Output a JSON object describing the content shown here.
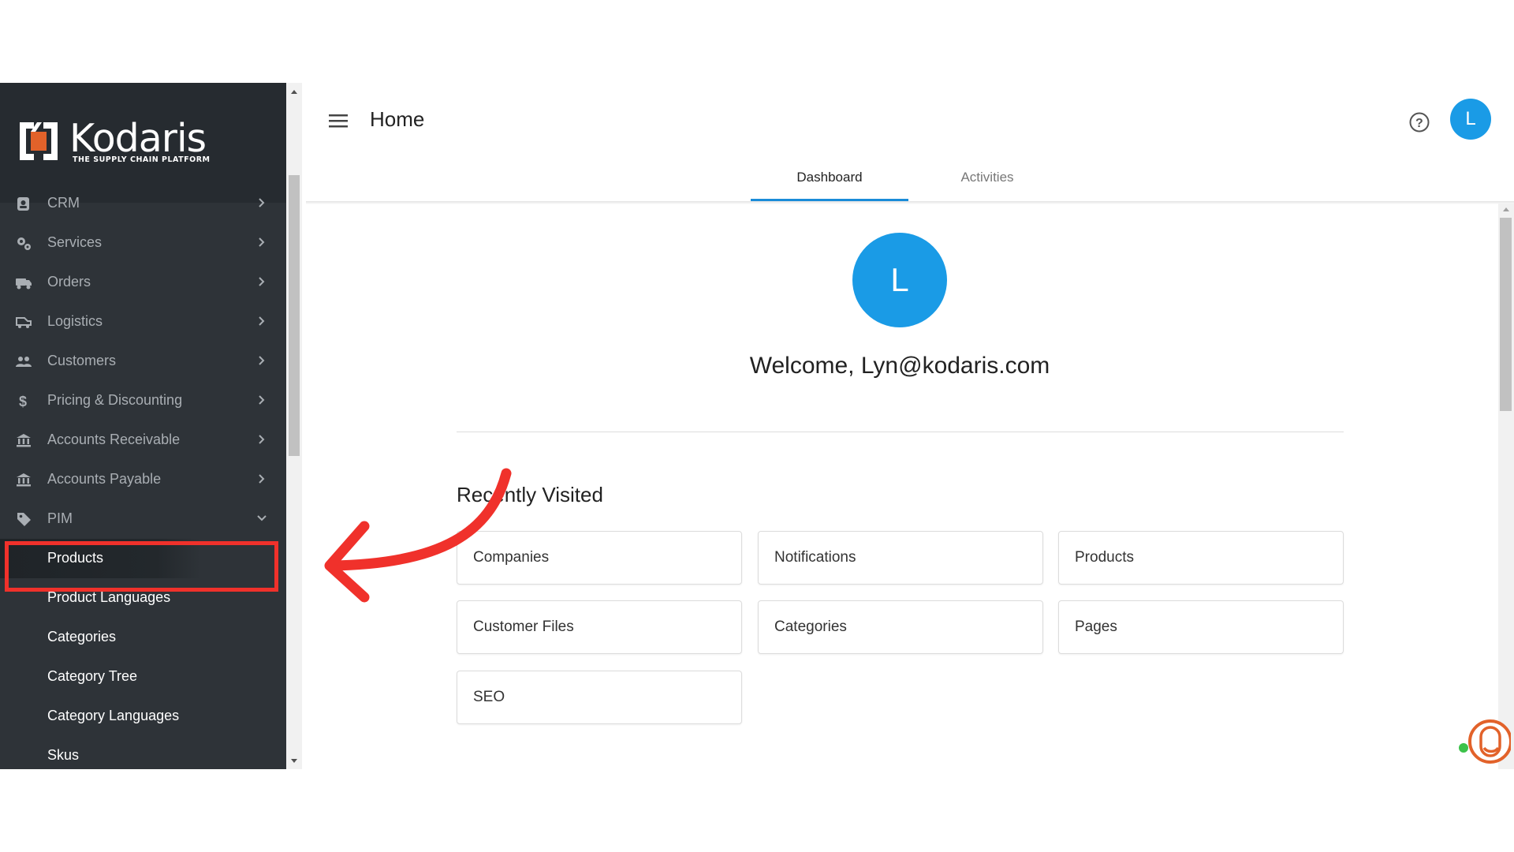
{
  "brand": {
    "name": "Kodaris",
    "tagline": "THE SUPPLY CHAIN PLATFORM",
    "accent": "#e2622a"
  },
  "header": {
    "title": "Home",
    "user_initial": "L"
  },
  "tabs": [
    {
      "label": "Dashboard",
      "active": true
    },
    {
      "label": "Activities",
      "active": false
    }
  ],
  "sidebar": {
    "items": [
      {
        "label": "CRM",
        "icon": "contact-card-icon"
      },
      {
        "label": "Services",
        "icon": "gears-icon"
      },
      {
        "label": "Orders",
        "icon": "truck-icon"
      },
      {
        "label": "Logistics",
        "icon": "shipping-icon"
      },
      {
        "label": "Customers",
        "icon": "people-icon"
      },
      {
        "label": "Pricing & Discounting",
        "icon": "dollar-icon"
      },
      {
        "label": "Accounts Receivable",
        "icon": "bank-icon"
      },
      {
        "label": "Accounts Payable",
        "icon": "bank-icon"
      },
      {
        "label": "PIM",
        "icon": "tag-icon"
      }
    ],
    "pim_subitems": [
      {
        "label": "Products",
        "active": true
      },
      {
        "label": "Product Languages"
      },
      {
        "label": "Categories"
      },
      {
        "label": "Category Tree"
      },
      {
        "label": "Category Languages"
      },
      {
        "label": "Skus"
      }
    ]
  },
  "main": {
    "avatar_initial": "L",
    "welcome": "Welcome, Lyn@kodaris.com",
    "recent_title": "Recently Visited",
    "recent": [
      "Companies",
      "Notifications",
      "Products",
      "Customer Files",
      "Categories",
      "Pages",
      "SEO"
    ]
  },
  "colors": {
    "sidebar_bg": "#2e3338",
    "primary": "#1a9be6",
    "annotation": "#f0312b"
  }
}
